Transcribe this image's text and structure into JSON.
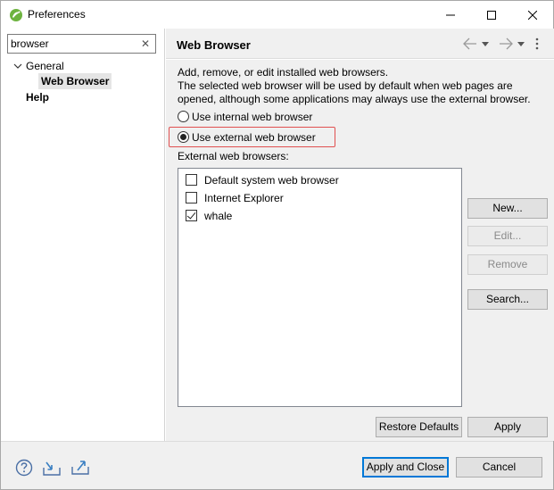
{
  "window": {
    "title": "Preferences",
    "app_icon": "eclipse-spring-icon"
  },
  "filter": {
    "value": "browser",
    "clear_icon": "clear-icon"
  },
  "tree": {
    "general_label": "General",
    "web_browser_label": "Web Browser",
    "help_label": "Help"
  },
  "page": {
    "title": "Web Browser",
    "description": "Add, remove, or edit installed web browsers.\nThe selected web browser will be used by default when web pages are opened, although some applications may always use the external browser.",
    "radio_internal": "Use internal web browser",
    "radio_external": "Use external web browser",
    "selected_mode": "external",
    "external_label": "External web browsers:",
    "browsers": [
      {
        "name": "Default system web browser",
        "checked": false
      },
      {
        "name": "Internet Explorer",
        "checked": false
      },
      {
        "name": "whale",
        "checked": true
      }
    ],
    "buttons": {
      "new": "New...",
      "edit": "Edit...",
      "remove": "Remove",
      "search": "Search...",
      "restore_defaults": "Restore Defaults",
      "apply": "Apply"
    }
  },
  "footer": {
    "apply_close": "Apply and Close",
    "cancel": "Cancel"
  },
  "colors": {
    "highlight_border": "#e05050",
    "panel_bg": "#f0f0f0",
    "accent": "#0078d7"
  }
}
